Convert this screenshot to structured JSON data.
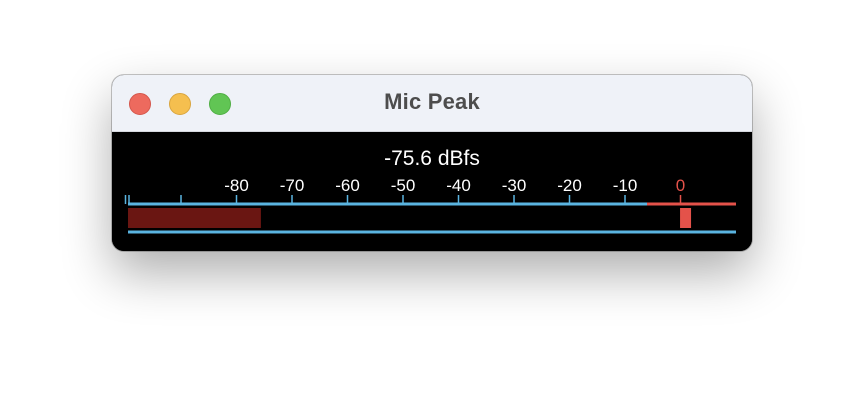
{
  "window": {
    "title": "Mic Peak",
    "controls": {
      "close": "close",
      "minimize": "minimize",
      "zoom": "zoom"
    }
  },
  "meter": {
    "readout": "-75.6 dBfs",
    "level_db": -75.6,
    "peak_hold_db": 1,
    "scale_labels": [
      {
        "text": "-80",
        "db": -80
      },
      {
        "text": "-70",
        "db": -70
      },
      {
        "text": "-60",
        "db": -60
      },
      {
        "text": "-50",
        "db": -50
      },
      {
        "text": "-40",
        "db": -40
      },
      {
        "text": "-30",
        "db": -30
      },
      {
        "text": "-20",
        "db": -20
      },
      {
        "text": "-10",
        "db": -10
      },
      {
        "text": "0",
        "db": 0
      }
    ],
    "tick_marks_db": [
      -100,
      -90,
      -80,
      -70,
      -60,
      -50,
      -40,
      -30,
      -20,
      -10,
      0
    ],
    "safe_color": "#5ab4e0",
    "over_color": "#e4524a",
    "bar_color": "#6a1612",
    "peak_color": "#e4524a",
    "label_color": "#ffffff",
    "zero_label_color": "#e4524a"
  }
}
